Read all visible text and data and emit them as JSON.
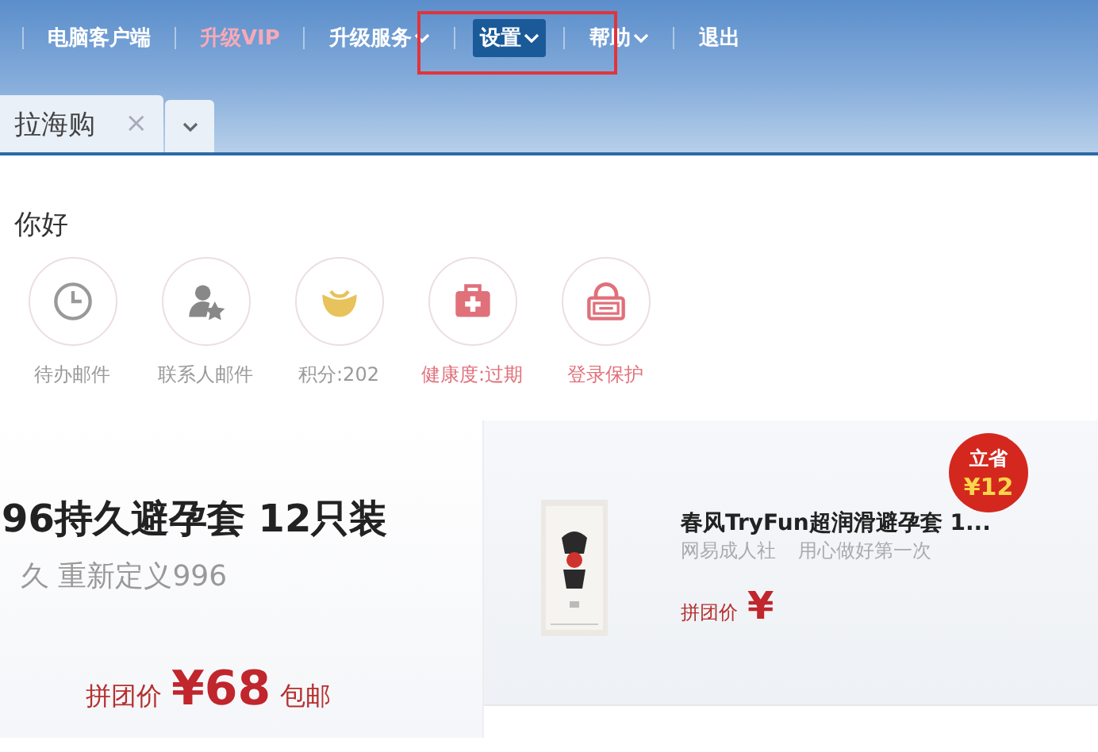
{
  "nav": [
    {
      "label": "电脑客户端",
      "kind": "plain",
      "dropdown": false,
      "selected": false
    },
    {
      "label": "升级VIP",
      "kind": "vip",
      "dropdown": false,
      "selected": false
    },
    {
      "label": "升级服务",
      "kind": "plain",
      "dropdown": true,
      "selected": false
    },
    {
      "label": "设置",
      "kind": "plain",
      "dropdown": true,
      "selected": true
    },
    {
      "label": "帮助",
      "kind": "plain",
      "dropdown": true,
      "selected": false
    },
    {
      "label": "退出",
      "kind": "plain",
      "dropdown": false,
      "selected": false
    }
  ],
  "tabs": [
    {
      "label": "拉海购",
      "closable": true,
      "close": "×"
    }
  ],
  "greeting": "你好",
  "shortcuts": [
    {
      "label": "待办邮件",
      "kind": "clock",
      "color": "#999999"
    },
    {
      "label": "联系人邮件",
      "kind": "contact",
      "color": "#999999"
    },
    {
      "label": "积分:202",
      "kind": "ingot",
      "color": "#999999"
    },
    {
      "label": "健康度:过期",
      "kind": "medkit",
      "color": "#e0707a"
    },
    {
      "label": "登录保护",
      "kind": "lock",
      "color": "#e0707a"
    }
  ],
  "featured": {
    "title": "96持久避孕套 12只装",
    "subtitle": "久 重新定义996",
    "price_label": "拼团价",
    "price": "¥68",
    "note": "包邮"
  },
  "side_product": {
    "title": "春风TryFun超润滑避孕套 1...",
    "subtitle": "网易成人社",
    "subtitle_2": "用心做好第一次",
    "price_label": "拼团价",
    "price": "¥",
    "badge_top": "立省",
    "badge_amount": "¥12"
  }
}
